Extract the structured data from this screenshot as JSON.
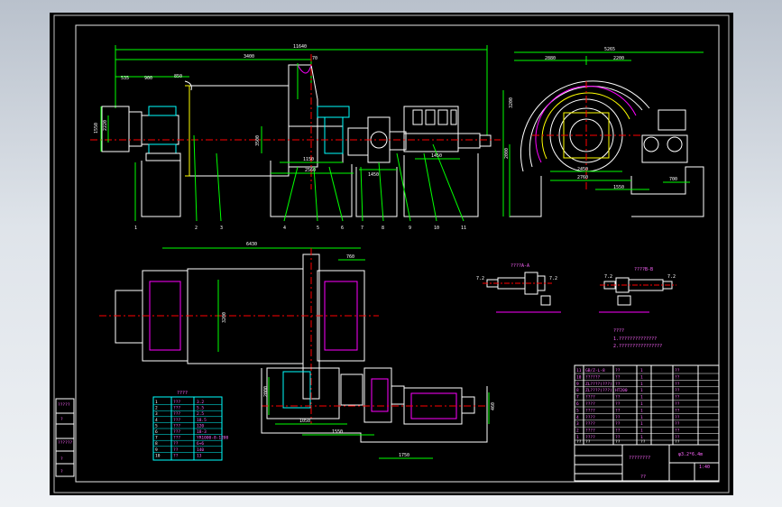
{
  "drawing": {
    "top_view_dims": {
      "overall_length": "11640",
      "d1": "535",
      "d2": "900",
      "d3": "850",
      "d4": "3400",
      "d5": "70",
      "left_dim_a": "1550",
      "left_dim_b": "2220",
      "shaft_height": "3500",
      "base_a": "1150",
      "base_b": "2560",
      "base_c": "1450",
      "base_d": "1450"
    },
    "side_view_dims": {
      "overall": "5265",
      "left": "2880",
      "right": "2200",
      "height": "3200",
      "lower_h": "2000",
      "base_left": "2450",
      "base_mid": "2760",
      "base_right": "1550",
      "base_far": "700"
    },
    "part_numbers": [
      "1",
      "2",
      "3",
      "4",
      "5",
      "6",
      "7",
      "8",
      "9",
      "10",
      "11"
    ],
    "plan_view_dims": {
      "length": "6430",
      "right_w": "760",
      "diameter": "3200",
      "lower_a": "2000",
      "lower_b": "1050",
      "lower_c": "1550",
      "lower_d": "1295",
      "lower_e": "2100",
      "lower_f": "1750",
      "motor_h": "460"
    },
    "detail_views": {
      "left_title": "????A-A",
      "left_a": "7.2",
      "left_b": "7.2",
      "right_title": "????B-B",
      "right_a": "7.2",
      "right_b": "7.2"
    },
    "notes_title": "????",
    "notes_lines": [
      "1.??????????????",
      "2.????????????????"
    ],
    "spec_table": {
      "title": "????",
      "rows": [
        [
          "1",
          "???",
          "3.2"
        ],
        [
          "2",
          "???",
          "5.5"
        ],
        [
          "3",
          "???",
          "2.5"
        ],
        [
          "4",
          "???",
          "18.5"
        ],
        [
          "5",
          "???",
          "120"
        ],
        [
          "6",
          "???",
          "18-3"
        ],
        [
          "7",
          "???",
          "YR1000-8-1200"
        ],
        [
          "8",
          "??",
          "6+6"
        ],
        [
          "9",
          "??",
          "140"
        ],
        [
          "10",
          "??",
          "13"
        ]
      ]
    },
    "parts_list": {
      "rows": [
        [
          "11",
          "GB/Z-L-8",
          "??",
          "1",
          "??"
        ],
        [
          "10",
          "??????",
          "??",
          "1",
          "??"
        ],
        [
          "9",
          "ZL????(???)",
          "??",
          "1",
          "??"
        ],
        [
          "8",
          "ZL????(???)",
          "HT200",
          "1",
          "??"
        ],
        [
          "7",
          "????",
          "??",
          "1",
          "??"
        ],
        [
          "6",
          "????",
          "??",
          "1",
          "??"
        ],
        [
          "5",
          "????",
          "??",
          "1",
          "??"
        ],
        [
          "4",
          "????",
          "??",
          "1",
          "??"
        ],
        [
          "3",
          "????",
          "??",
          "1",
          "??"
        ],
        [
          "2",
          "????",
          "??",
          "1",
          "??"
        ],
        [
          "1",
          "????",
          "??",
          "1",
          "??"
        ]
      ],
      "header": [
        "??",
        "??",
        "??",
        "??",
        "??"
      ]
    },
    "title_block": {
      "name": "????????",
      "scale": "1:40",
      "drawing_no": "φ3.2*6.4m",
      "sheet_label": "??"
    },
    "left_side_block": [
      "?????",
      "?",
      "??????",
      "?",
      "?"
    ]
  }
}
